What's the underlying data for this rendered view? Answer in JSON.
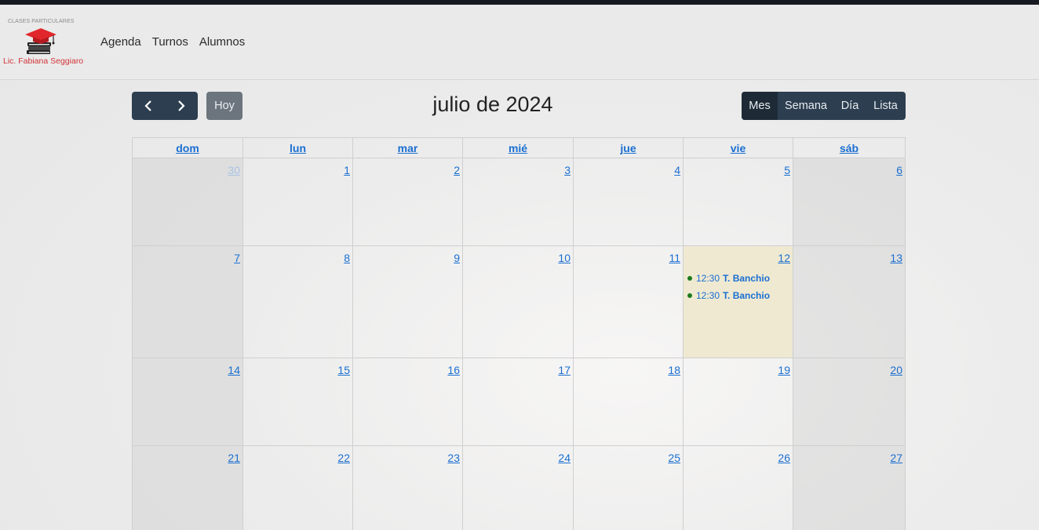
{
  "brand": {
    "top_text": "CLASES PARTICULARES",
    "bottom_text": "Lic. Fabiana Seggiaro",
    "icon": "graduation-cap-books-icon"
  },
  "nav": {
    "items": [
      {
        "label": "Agenda"
      },
      {
        "label": "Turnos"
      },
      {
        "label": "Alumnos"
      }
    ]
  },
  "toolbar": {
    "prev_icon": "chevron-left-icon",
    "next_icon": "chevron-right-icon",
    "today_label": "Hoy",
    "title": "julio de 2024",
    "views": [
      {
        "label": "Mes",
        "active": true
      },
      {
        "label": "Semana",
        "active": false
      },
      {
        "label": "Día",
        "active": false
      },
      {
        "label": "Lista",
        "active": false
      }
    ]
  },
  "calendar": {
    "weekdays": [
      "dom",
      "lun",
      "mar",
      "mié",
      "jue",
      "vie",
      "sáb"
    ],
    "weeks": [
      [
        "30",
        "1",
        "2",
        "3",
        "4",
        "5",
        "6"
      ],
      [
        "7",
        "8",
        "9",
        "10",
        "11",
        "12",
        "13"
      ],
      [
        "14",
        "15",
        "16",
        "17",
        "18",
        "19",
        "20"
      ],
      [
        "21",
        "22",
        "23",
        "24",
        "25",
        "26",
        "27"
      ]
    ],
    "other_month_day": "30",
    "today": "12",
    "events": [
      {
        "day": "12",
        "time": "12:30",
        "title": "T. Banchio"
      },
      {
        "day": "12",
        "time": "12:30",
        "title": "T. Banchio"
      }
    ],
    "colors": {
      "link": "#1a6fd1",
      "today_bg": "#efe9d2",
      "event_dot": "#1b7a1b",
      "toolbar_bg": "#2c3e50"
    }
  }
}
